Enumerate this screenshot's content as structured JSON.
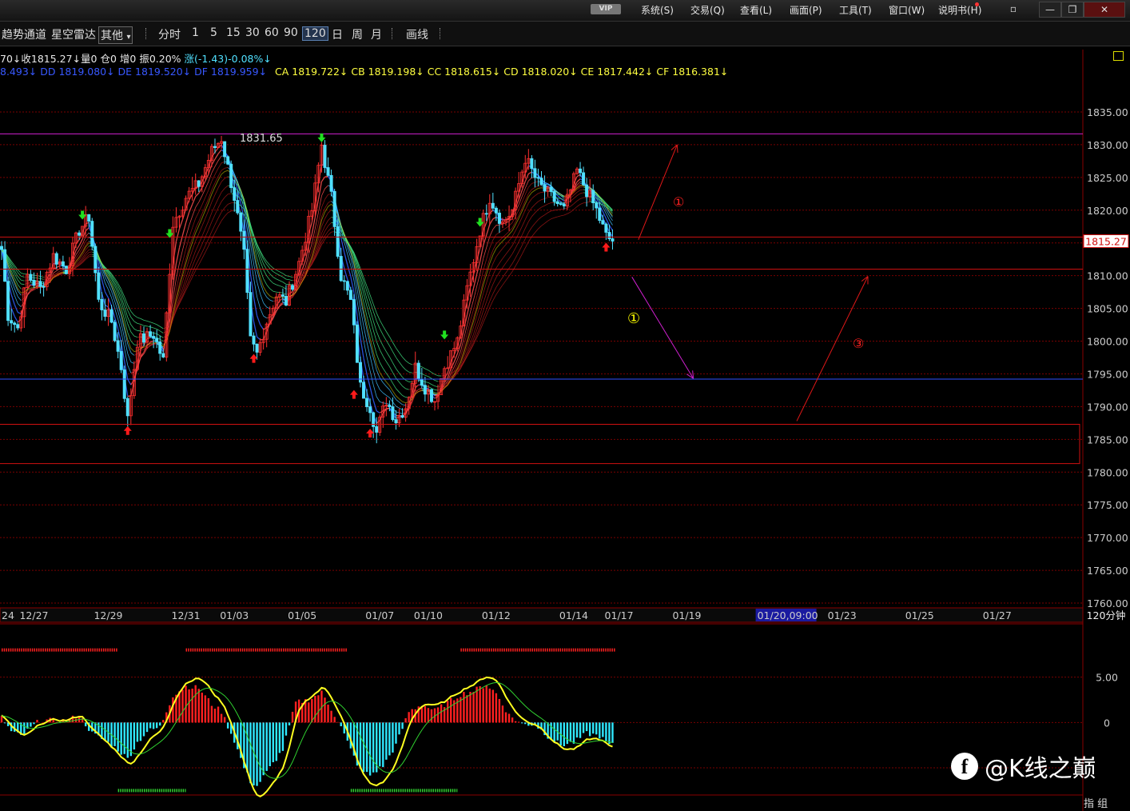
{
  "titlebar": {
    "vip": "VIP",
    "menus": [
      "系统(S)",
      "交易(Q)",
      "查看(L)",
      "画面(P)",
      "工具(T)",
      "窗口(W)",
      "说明书(H)"
    ],
    "win_buttons": [
      "▫",
      "—",
      "❐",
      "✕"
    ]
  },
  "toolbar": {
    "indicator1": "趋势通道",
    "indicator2": "星空雷达",
    "dropdown": "其他",
    "dropdown_arrow": "▾",
    "periods": [
      "分时",
      "1",
      "5",
      "15",
      "30",
      "60",
      "90",
      "120",
      "日",
      "周",
      "月"
    ],
    "selected_period": "120",
    "draw": "画线"
  },
  "info": {
    "line1_left": "70↓收1815.27↓量0  仓0  增0 振0.20%",
    "line1_change": "涨(-1.43)-0.08%↓",
    "line2_blue": "8.493↓  DD 1819.080↓  DE 1819.520↓  DF 1819.959↓",
    "line2_yellow": "CA 1819.722↓  CB 1819.198↓  CC 1818.615↓  CD 1818.020↓  CE 1817.442↓  CF 1816.381↓"
  },
  "colors": {
    "up": "#ff3030",
    "down": "#50e0ff",
    "grid": "#7a0000",
    "axis_text": "#cccccc",
    "magenta": "#d020d0",
    "blue_line": "#3050ff",
    "yellow": "#ffff00",
    "green": "#30e030"
  },
  "annotations": {
    "high_label": "1831.65",
    "circle1_red": "①",
    "circle1_yellow": "①",
    "circle3_red": "③"
  },
  "watermark": {
    "logo": "f",
    "text": "@K线之巅"
  },
  "bottom_tab": "指 组",
  "chart_data": [
    {
      "type": "candlestick",
      "period_label": "120分钟",
      "last_price": "1815.27",
      "y_ticks": [
        "1835.00",
        "1830.00",
        "1825.00",
        "1820.00",
        "1815.00",
        "1810.00",
        "1805.00",
        "1800.00",
        "1795.00",
        "1790.00",
        "1785.00",
        "1780.00",
        "1775.00",
        "1770.00",
        "1765.00",
        "1760.00"
      ],
      "ylim": [
        1759,
        1862
      ],
      "x_labels": [
        {
          "label": "24",
          "idx": 0
        },
        {
          "label": "12/27",
          "idx": 10
        },
        {
          "label": "12/29",
          "idx": 33
        },
        {
          "label": "12/31",
          "idx": 57
        },
        {
          "label": "01/03",
          "idx": 72
        },
        {
          "label": "01/05",
          "idx": 93
        },
        {
          "label": "01/07",
          "idx": 117
        },
        {
          "label": "01/10",
          "idx": 132
        },
        {
          "label": "01/12",
          "idx": 153
        },
        {
          "label": "01/14",
          "idx": 177
        },
        {
          "label": "01/17",
          "idx": 191
        },
        {
          "label": "01/19",
          "idx": 212
        },
        {
          "label": "01/20,09:00",
          "idx": 236,
          "highlight": true
        },
        {
          "label": "01/23",
          "idx": 260
        },
        {
          "label": "01/25",
          "idx": 284
        },
        {
          "label": "01/27",
          "idx": 308
        }
      ],
      "x_slots": 335,
      "anchors": [
        [
          0,
          1814
        ],
        [
          2,
          1804
        ],
        [
          5,
          1802
        ],
        [
          8,
          1810
        ],
        [
          12,
          1808
        ],
        [
          16,
          1813
        ],
        [
          20,
          1811
        ],
        [
          24,
          1817
        ],
        [
          27,
          1819
        ],
        [
          30,
          1806
        ],
        [
          34,
          1803
        ],
        [
          37,
          1796
        ],
        [
          39,
          1788
        ],
        [
          42,
          1800
        ],
        [
          47,
          1801
        ],
        [
          50,
          1797
        ],
        [
          53,
          1818
        ],
        [
          57,
          1822
        ],
        [
          61,
          1824
        ],
        [
          65,
          1829
        ],
        [
          68,
          1831
        ],
        [
          72,
          1822
        ],
        [
          75,
          1813
        ],
        [
          77,
          1800
        ],
        [
          79,
          1798
        ],
        [
          82,
          1803
        ],
        [
          85,
          1807
        ],
        [
          88,
          1806
        ],
        [
          92,
          1812
        ],
        [
          96,
          1820
        ],
        [
          99,
          1830
        ],
        [
          102,
          1822
        ],
        [
          105,
          1810
        ],
        [
          108,
          1806
        ],
        [
          111,
          1793
        ],
        [
          114,
          1790
        ],
        [
          116,
          1786
        ],
        [
          119,
          1791
        ],
        [
          122,
          1788
        ],
        [
          125,
          1790
        ],
        [
          128,
          1796
        ],
        [
          131,
          1793
        ],
        [
          134,
          1791
        ],
        [
          137,
          1796
        ],
        [
          141,
          1800
        ],
        [
          144,
          1808
        ],
        [
          148,
          1817
        ],
        [
          151,
          1822
        ],
        [
          155,
          1818
        ],
        [
          158,
          1820
        ],
        [
          162,
          1828
        ],
        [
          166,
          1824
        ],
        [
          170,
          1822
        ],
        [
          174,
          1820
        ],
        [
          178,
          1826
        ],
        [
          181,
          1823
        ],
        [
          184,
          1820
        ],
        [
          187,
          1816
        ],
        [
          189,
          1815.27
        ]
      ],
      "horizontal_lines": [
        {
          "price": 1831.65,
          "color": "magenta"
        },
        {
          "price": 1815.9,
          "color": "red"
        },
        {
          "price": 1811.0,
          "color": "red"
        },
        {
          "price": 1794.2,
          "color": "blue"
        }
      ],
      "box": {
        "top": 1787.3,
        "bottom": 1781.3
      },
      "arrows": [
        {
          "from": [
            197,
            1815.5
          ],
          "to": [
            209,
            1830.0
          ],
          "color": "red"
        },
        {
          "from": [
            195,
            1809.8
          ],
          "to": [
            214,
            1794.3
          ],
          "color": "magenta"
        },
        {
          "from": [
            246,
            1787.8
          ],
          "to": [
            268,
            1809.9
          ],
          "color": "red"
        }
      ],
      "signals_up": [
        [
          39,
          1786.3
        ],
        [
          78,
          1797.3
        ],
        [
          109,
          1791.8
        ],
        [
          114,
          1785.9
        ],
        [
          187,
          1814.3
        ]
      ],
      "signals_down": [
        [
          25,
          1819.3
        ],
        [
          52,
          1816.5
        ],
        [
          99,
          1831.1
        ],
        [
          137,
          1801.0
        ],
        [
          148,
          1818.2
        ]
      ]
    },
    {
      "type": "macd",
      "y_ticks": [
        "5.00",
        "0"
      ],
      "ylim": [
        -8,
        10
      ],
      "anchors": [
        [
          0,
          0.5
        ],
        [
          3,
          -1
        ],
        [
          6,
          -1.5
        ],
        [
          9,
          -0.6
        ],
        [
          12,
          0.3
        ],
        [
          16,
          0.2
        ],
        [
          20,
          0.2
        ],
        [
          24,
          0.8
        ],
        [
          28,
          -1.2
        ],
        [
          32,
          -2
        ],
        [
          36,
          -3
        ],
        [
          39,
          -4
        ],
        [
          42,
          -2.2
        ],
        [
          45,
          -1
        ],
        [
          49,
          -0.5
        ],
        [
          53,
          3
        ],
        [
          57,
          4
        ],
        [
          61,
          3.8
        ],
        [
          65,
          2
        ],
        [
          68,
          1.2
        ],
        [
          72,
          -2
        ],
        [
          75,
          -5
        ],
        [
          77,
          -6.5
        ],
        [
          79,
          -7
        ],
        [
          83,
          -5
        ],
        [
          87,
          -3
        ],
        [
          91,
          2.2
        ],
        [
          95,
          2.5
        ],
        [
          99,
          3.3
        ],
        [
          102,
          1.5
        ],
        [
          105,
          -0.5
        ],
        [
          108,
          -3
        ],
        [
          111,
          -5.3
        ],
        [
          114,
          -5.8
        ],
        [
          118,
          -4.8
        ],
        [
          122,
          -2.5
        ],
        [
          126,
          1.2
        ],
        [
          130,
          2
        ],
        [
          134,
          1.3
        ],
        [
          138,
          2.2
        ],
        [
          142,
          3.1
        ],
        [
          146,
          3.5
        ],
        [
          150,
          4.2
        ],
        [
          153,
          3.2
        ],
        [
          157,
          0.8
        ],
        [
          161,
          -0.2
        ],
        [
          165,
          -0.2
        ],
        [
          169,
          -1.5
        ],
        [
          173,
          -2.5
        ],
        [
          177,
          -2.2
        ],
        [
          181,
          -1.2
        ],
        [
          185,
          -1.5
        ],
        [
          188,
          -2.5
        ]
      ],
      "dots_red": [
        [
          0,
          8
        ],
        [
          36,
          8
        ],
        [
          57,
          8
        ],
        [
          107,
          8
        ],
        [
          142,
          8
        ],
        [
          190,
          8
        ]
      ],
      "dots_green": [
        [
          36,
          -7.5
        ],
        [
          57,
          -7.5
        ],
        [
          108,
          -7.5
        ],
        [
          141,
          -7.5
        ]
      ]
    }
  ]
}
